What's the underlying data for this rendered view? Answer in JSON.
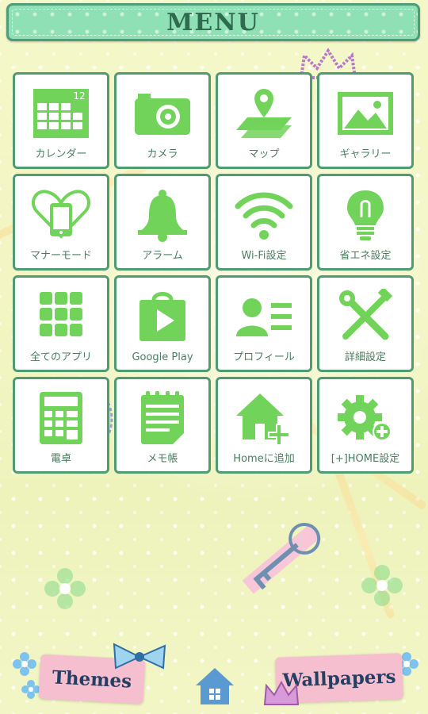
{
  "header": {
    "title": "MENU"
  },
  "tiles": [
    {
      "label": "カレンダー",
      "icon": "calendar-icon",
      "badge": "12"
    },
    {
      "label": "カメラ",
      "icon": "camera-icon"
    },
    {
      "label": "マップ",
      "icon": "map-icon"
    },
    {
      "label": "ギャラリー",
      "icon": "gallery-icon"
    },
    {
      "label": "マナーモード",
      "icon": "manner-mode-icon"
    },
    {
      "label": "アラーム",
      "icon": "bell-icon"
    },
    {
      "label": "Wi-Fi設定",
      "icon": "wifi-icon"
    },
    {
      "label": "省エネ設定",
      "icon": "lightbulb-icon"
    },
    {
      "label": "全てのアプリ",
      "icon": "apps-grid-icon"
    },
    {
      "label": "Google Play",
      "icon": "play-store-icon"
    },
    {
      "label": "プロフィール",
      "icon": "profile-icon"
    },
    {
      "label": "詳細設定",
      "icon": "tools-icon"
    },
    {
      "label": "電卓",
      "icon": "calculator-icon"
    },
    {
      "label": "メモ帳",
      "icon": "notepad-icon"
    },
    {
      "label": "Homeに追加",
      "icon": "home-add-icon"
    },
    {
      "label": "[+]HOME設定",
      "icon": "gear-plus-icon"
    }
  ],
  "bottom_nav": {
    "themes_label": "Themes",
    "wallpapers_label": "Wallpapers",
    "home_icon": "home-icon"
  },
  "colors": {
    "icon_green": "#72d35a",
    "border_green": "#4f9c73",
    "header_green": "#8fe0b4",
    "label_green": "#4b7d5e"
  }
}
